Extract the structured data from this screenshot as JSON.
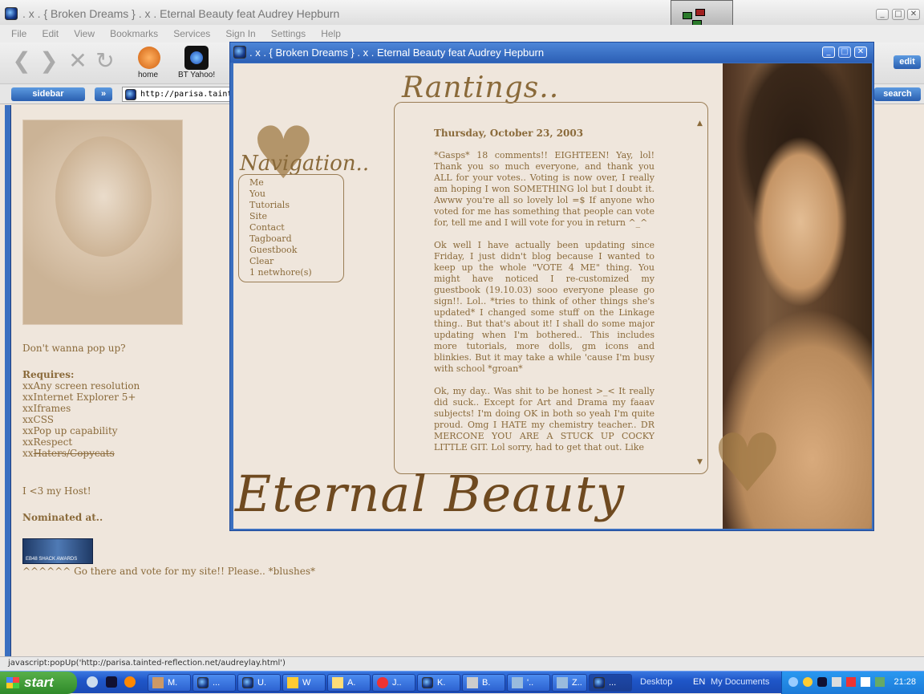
{
  "browser": {
    "title": ". x . { Broken Dreams } . x .      Eternal Beauty feat Audrey Hepburn",
    "menu": [
      "File",
      "Edit",
      "View",
      "Bookmarks",
      "Services",
      "Sign In",
      "Settings",
      "Help"
    ],
    "toolbar": {
      "home_label": "home",
      "yahoo_label": "BT Yahoo!",
      "edit_label": "edit"
    },
    "sidebar_label": "sidebar",
    "search_label": "search",
    "url": "http://parisa.tainted-r",
    "status": "javascript:popUp('http://parisa.tainted-reflection.net/audreylay.html')"
  },
  "left": {
    "popup_note": "Don't wanna pop up?",
    "requires_title": "Requires:",
    "requirements": [
      "xxAny screen resolution",
      "xxInternet Explorer 5+",
      "xxIframes",
      "xxCSS",
      "xxPop up capability",
      "xxRespect"
    ],
    "struck_prefix": "xx",
    "struck_text": "Haters/Copycats",
    "host": "I <3 my Host!",
    "nominated": "Nominated at..",
    "badge_text": "EB48 SHACK AWARDS",
    "vote": "^^^^^^ Go there and vote for my site!! Please.. *blushes*"
  },
  "popup": {
    "title": ". x . { Broken Dreams } . x .       Eternal Beauty feat Audrey Hepburn",
    "rantings_title": "Rantings..",
    "nav_title": "Navigation..",
    "nav_items": [
      "Me",
      "You",
      "Tutorials",
      "Site",
      "Contact",
      "Tagboard",
      "Guestbook",
      "Clear",
      "1 netwhore(s)"
    ],
    "date": "Thursday, October 23, 2003",
    "paragraphs": [
      "*Gasps* 18 comments!! EIGHTEEN! Yay, lol! Thank you so much everyone, and thank you ALL for your votes.. Voting is now over, I really am hoping I won SOMETHING lol but I doubt it. Awww you're all so lovely lol =$ If anyone who voted for me has something that people can vote for, tell me and I will vote for you in return ^_^",
      "Ok well I have actually been updating since Friday, I just didn't blog because I wanted to keep up the whole \"VOTE 4 ME\" thing. You might have noticed I re-customized my guestbook (19.10.03) sooo everyone please go sign!!. Lol.. *tries to think of other things she's updated* I changed some stuff on the Linkage thing.. But that's about it! I shall do some major updating when I'm bothered.. This includes more tutorials, more dolls, gm icons and blinkies. But it may take a while 'cause I'm busy with school *groan*",
      "Ok, my day.. Was shit to be honest >_< It really did suck.. Except for Art and Drama my faaav subjects! I'm doing OK in both so yeah I'm quite proud. Omg I HATE my chemistry teacher.. DR MERCONE YOU ARE A STUCK UP COCKY LITTLE GIT. Lol sorry, had to get that out. Like"
    ],
    "footer_title": "Eternal Beauty"
  },
  "taskbar": {
    "start": "start",
    "items": [
      "M.",
      "...",
      "U.",
      "W",
      "A.",
      "J..",
      "K.",
      "B.",
      "'..",
      "Z..",
      "..."
    ],
    "desktop": "Desktop",
    "lang": "EN",
    "mydocs": "My Documents",
    "clock": "21:28"
  },
  "colors": {
    "accent": "#8a6a3a",
    "page_bg": "#efe6dc",
    "titlebar": "#2c5fb5"
  }
}
